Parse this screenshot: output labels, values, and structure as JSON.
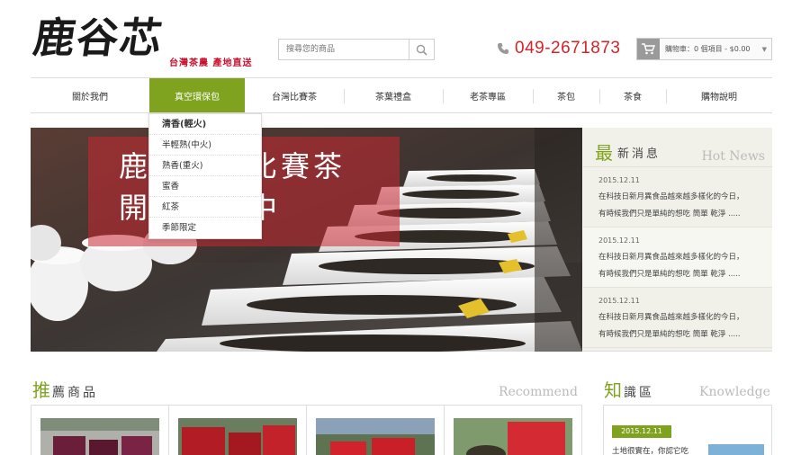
{
  "brand": {
    "logo_text": "鹿谷芯",
    "slogan": "台灣茶農 產地直送"
  },
  "search": {
    "placeholder": "搜尋您的商品",
    "icon": "search-icon"
  },
  "contact": {
    "phone_icon": "phone-icon",
    "phone": "049-2671873"
  },
  "cart": {
    "icon": "shopping-cart-icon",
    "label": "購物車：0 個項目 - $0.00"
  },
  "nav": {
    "items": [
      {
        "label": "關於我們"
      },
      {
        "label": "真空環保包"
      },
      {
        "label": "台灣比賽茶"
      },
      {
        "label": "茶葉禮盒"
      },
      {
        "label": "老茶專區"
      },
      {
        "label": "茶包"
      },
      {
        "label": "茶食"
      },
      {
        "label": "購物說明"
      }
    ],
    "active_index": 1,
    "accent_color": "#7fa31f"
  },
  "dropdown": {
    "items": [
      {
        "label": "清香(輕火)"
      },
      {
        "label": "半輕熟(中火)"
      },
      {
        "label": "熟香(重火)"
      },
      {
        "label": "蜜香"
      },
      {
        "label": "紅茶"
      },
      {
        "label": "季節限定"
      }
    ]
  },
  "hero": {
    "line1": "鹿　　　比賽茶",
    "line2": "開　　　中"
  },
  "news": {
    "big_char": "最",
    "title": "新消息",
    "title_en": "Hot News",
    "items": [
      {
        "date": "2015.12.11",
        "line1": "在科技日新月異食品越來越多樣化的今日，",
        "line2": "有時候我們只是單純的想吃 簡單 乾淨 ....."
      },
      {
        "date": "2015.12.11",
        "line1": "在科技日新月異食品越來越多樣化的今日，",
        "line2": "有時候我們只是單純的想吃 簡單 乾淨 ....."
      },
      {
        "date": "2015.12.11",
        "line1": "在科技日新月異食品越來越多樣化的今日，",
        "line2": "有時候我們只是單純的想吃 簡單 乾淨 ....."
      }
    ]
  },
  "recommend": {
    "big_char": "推",
    "title": "薦商品",
    "title_en": "Recommend"
  },
  "knowledge": {
    "big_char": "知",
    "title": "識區",
    "title_en": "Knowledge",
    "date": "2015.12.11",
    "text": "土地很實在，你認它吃"
  }
}
